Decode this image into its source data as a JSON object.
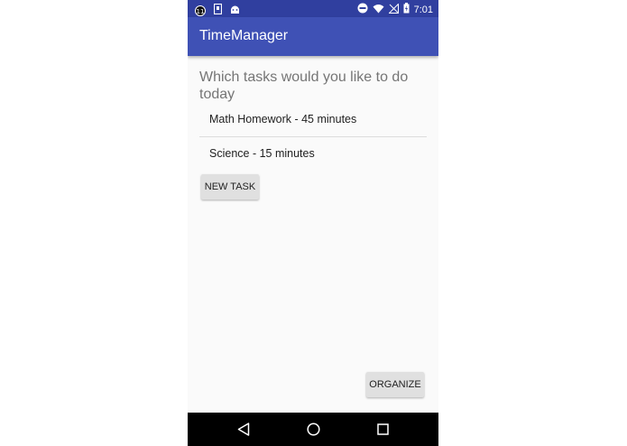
{
  "status_bar": {
    "notification_badge": "11",
    "time": "7:01",
    "icons": [
      "notification-badge-icon",
      "sim-card-icon",
      "android-icon",
      "do-not-disturb-icon",
      "wifi-icon",
      "no-signal-icon",
      "battery-charging-icon"
    ]
  },
  "app_bar": {
    "title": "TimeManager",
    "color": "#3f51b5",
    "status_color": "#303f9f"
  },
  "main": {
    "prompt": "Which tasks would you like to do today",
    "tasks": [
      "Math Homework - 45 minutes",
      "Science - 15 minutes"
    ],
    "new_task_label": "NEW TASK",
    "organize_label": "ORGANIZE"
  },
  "nav_bar": {
    "icons": [
      "back-icon",
      "home-icon",
      "recents-icon"
    ]
  }
}
